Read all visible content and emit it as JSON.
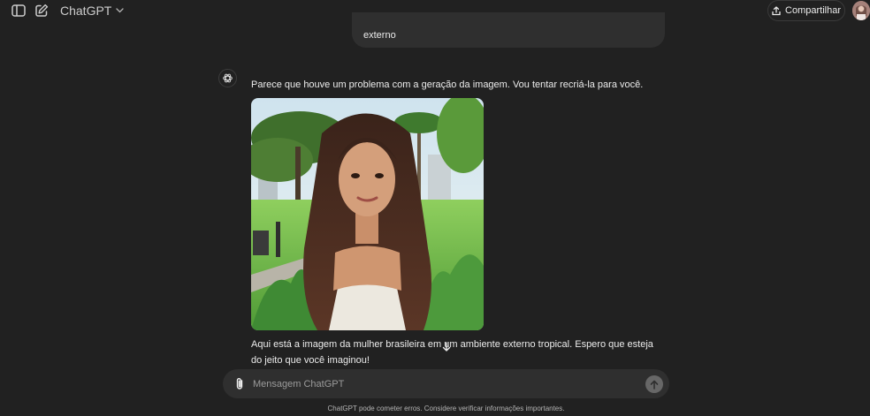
{
  "header": {
    "model_name": "ChatGPT",
    "share_label": "Compartilhar"
  },
  "icons": {
    "sidebar": "sidebar-toggle-icon",
    "new_chat": "edit-icon",
    "model_chevron": "chevron-down-icon",
    "share": "share-icon",
    "assistant": "openai-logo-icon",
    "scroll": "arrow-down-icon",
    "attach": "paperclip-icon",
    "send": "arrow-up-icon"
  },
  "conversation": {
    "user_message_tail": "externo",
    "assistant_intro": "Parece que houve um problema com a geração da imagem. Vou tentar recriá-la para você.",
    "assistant_followup": "Aqui está a imagem da mulher brasileira em um ambiente externo tropical. Espero que esteja do jeito que você imaginou!"
  },
  "composer": {
    "placeholder": "Mensagem ChatGPT"
  },
  "footer": {
    "disclaimer": "ChatGPT pode cometer erros. Considere verificar informações importantes."
  },
  "colors": {
    "background": "#212121",
    "bubble": "#2f2f2f",
    "text": "#ececec",
    "muted": "#9b9b9b"
  }
}
